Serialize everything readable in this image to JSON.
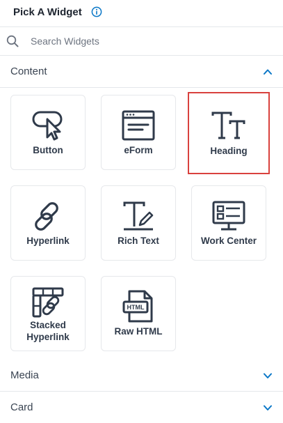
{
  "header": {
    "title": "Pick A Widget",
    "info_icon": "info-circle-icon"
  },
  "search": {
    "placeholder": "Search Widgets",
    "value": ""
  },
  "sections": {
    "content": {
      "label": "Content",
      "expanded": true,
      "widgets": [
        {
          "label": "Button",
          "icon": "pointer-button-icon"
        },
        {
          "label": "eForm",
          "icon": "form-window-icon"
        },
        {
          "label": "Heading",
          "icon": "heading-tt-icon",
          "selected": true
        },
        {
          "label": "Hyperlink",
          "icon": "chain-link-icon"
        },
        {
          "label": "Rich Text",
          "icon": "text-pencil-icon"
        },
        {
          "label": "Work Center",
          "icon": "monitor-list-icon"
        },
        {
          "label": "Stacked\nHyperlink",
          "icon": "stacked-link-icon"
        },
        {
          "label": "Raw HTML",
          "icon": "html-file-icon"
        }
      ]
    },
    "media": {
      "label": "Media",
      "expanded": false
    },
    "card": {
      "label": "Card",
      "expanded": false
    }
  },
  "colors": {
    "accent": "#0a77c7",
    "selected_border": "#d9413d",
    "icon": "#2f3a4a"
  }
}
